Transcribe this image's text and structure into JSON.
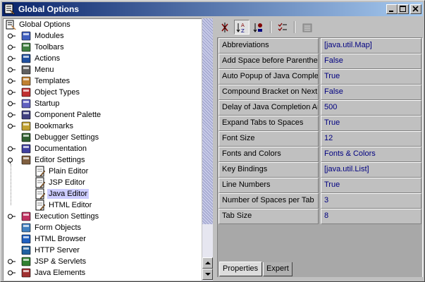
{
  "window": {
    "title": "Global Options"
  },
  "tree": {
    "root": "Global Options",
    "items": [
      {
        "label": "Modules",
        "icon": "modules-icon"
      },
      {
        "label": "Toolbars",
        "icon": "toolbars-icon"
      },
      {
        "label": "Actions",
        "icon": "actions-icon"
      },
      {
        "label": "Menu",
        "icon": "menu-icon"
      },
      {
        "label": "Templates",
        "icon": "templates-icon"
      },
      {
        "label": "Object Types",
        "icon": "object-types-icon"
      },
      {
        "label": "Startup",
        "icon": "startup-icon"
      },
      {
        "label": "Component Palette",
        "icon": "component-palette-icon"
      },
      {
        "label": "Bookmarks",
        "icon": "bookmarks-icon"
      },
      {
        "label": "Debugger Settings",
        "icon": "debugger-icon"
      },
      {
        "label": "Documentation",
        "icon": "documentation-icon"
      },
      {
        "label": "Editor Settings",
        "icon": "editor-settings-icon"
      },
      {
        "label": "Plain Editor",
        "icon": "plain-editor-icon"
      },
      {
        "label": "JSP Editor",
        "icon": "jsp-editor-icon"
      },
      {
        "label": "Java Editor",
        "icon": "java-editor-icon"
      },
      {
        "label": "HTML Editor",
        "icon": "html-editor-icon"
      },
      {
        "label": "Execution Settings",
        "icon": "execution-icon"
      },
      {
        "label": "Form Objects",
        "icon": "form-objects-icon"
      },
      {
        "label": "HTML Browser",
        "icon": "html-browser-icon"
      },
      {
        "label": "HTTP Server",
        "icon": "http-server-icon"
      },
      {
        "label": "JSP & Servlets",
        "icon": "jsp-servlets-icon"
      },
      {
        "label": "Java Elements",
        "icon": "java-elements-icon"
      }
    ],
    "selected": "Java Editor"
  },
  "toolbar": {
    "buttons": [
      "unsorted-icon",
      "sort-by-name-icon",
      "sort-by-type-icon",
      "show-checklist-icon",
      "customize-icon"
    ]
  },
  "properties": [
    {
      "name": "Abbreviations",
      "value": "[java.util.Map]"
    },
    {
      "name": "Add Space before Parenthe",
      "value": "False"
    },
    {
      "name": "Auto Popup of Java Complet",
      "value": "True"
    },
    {
      "name": "Compound Bracket on Next I",
      "value": "False"
    },
    {
      "name": "Delay of Java Completion Au",
      "value": "500"
    },
    {
      "name": "Expand Tabs to Spaces",
      "value": "True"
    },
    {
      "name": "Font Size",
      "value": "12"
    },
    {
      "name": "Fonts and Colors",
      "value": "Fonts & Colors"
    },
    {
      "name": "Key Bindings",
      "value": "[java.util.List]"
    },
    {
      "name": "Line Numbers",
      "value": "True"
    },
    {
      "name": "Number of Spaces per Tab",
      "value": "3"
    },
    {
      "name": "Tab Size",
      "value": "8"
    }
  ],
  "tabs": [
    {
      "label": "Properties",
      "active": true
    },
    {
      "label": "Expert",
      "active": false
    }
  ],
  "colors": {
    "title_start": "#0a246a",
    "title_end": "#a6caf0",
    "value_text": "#000080",
    "selection": "#ccccff"
  }
}
